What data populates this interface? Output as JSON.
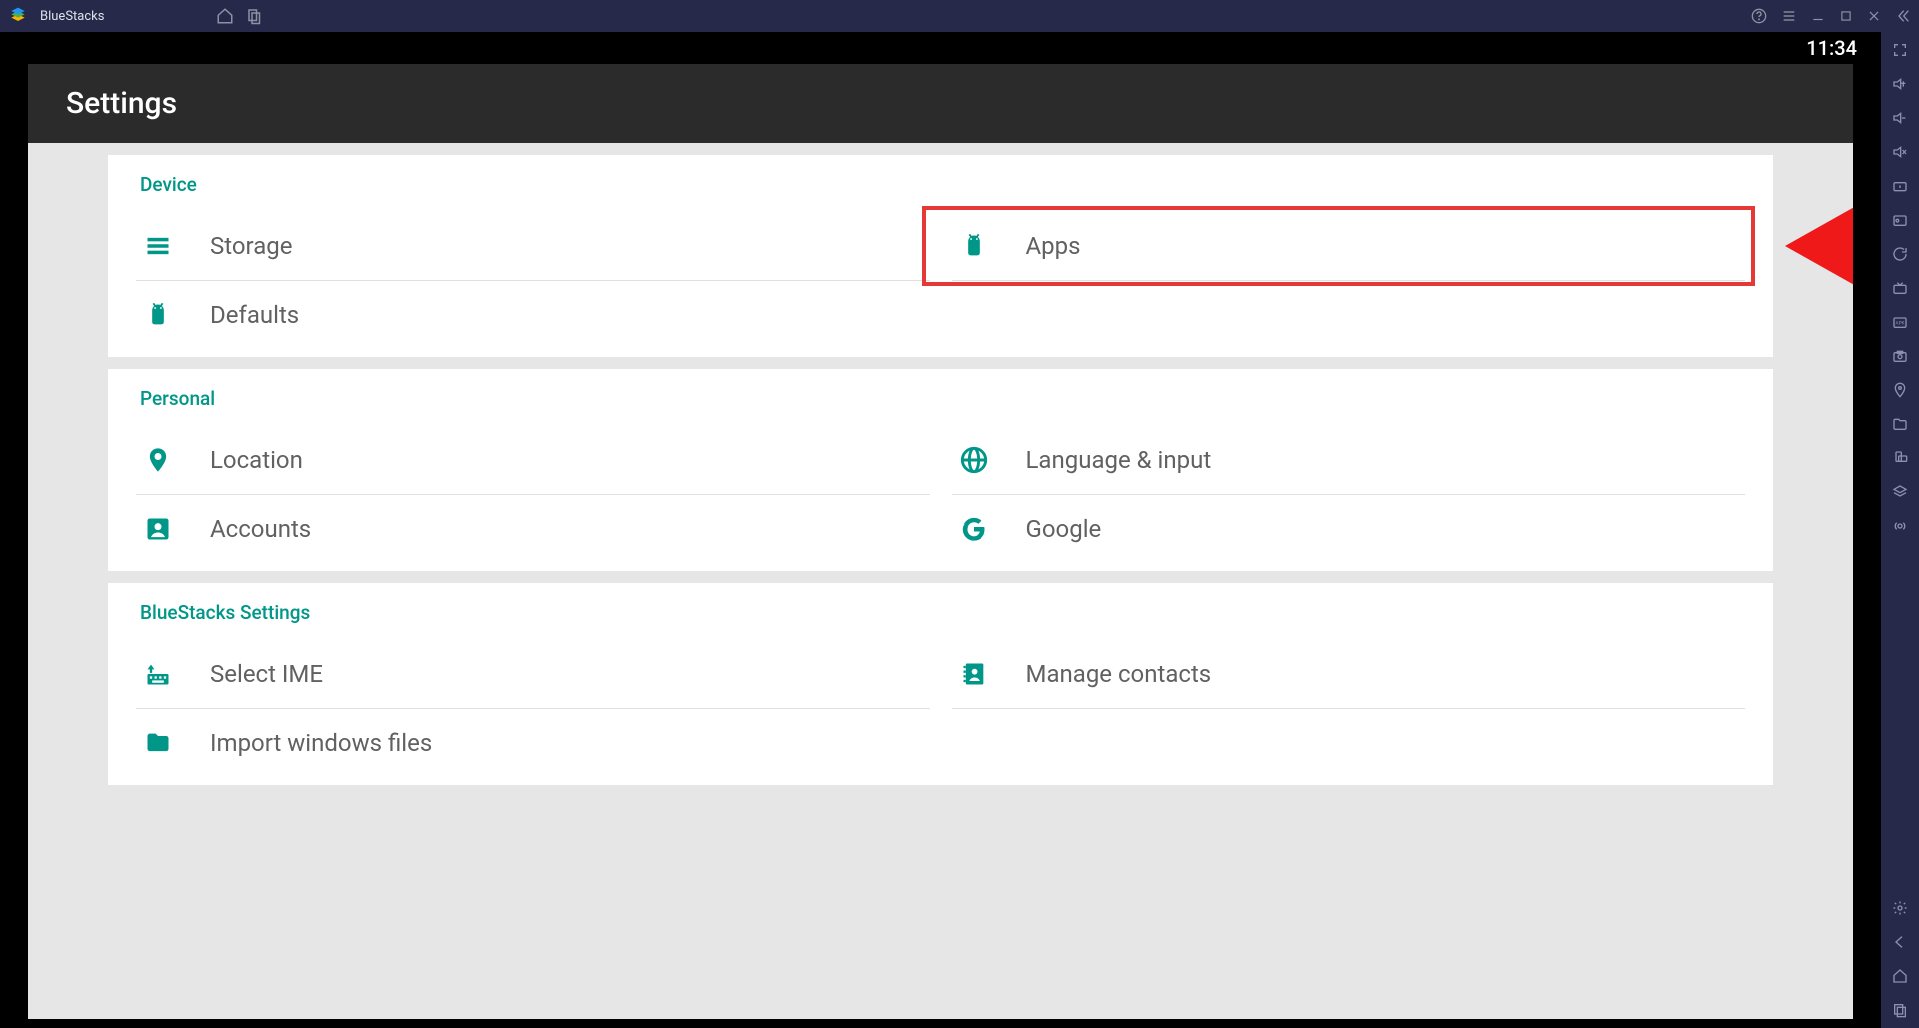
{
  "app_title": "BlueStacks",
  "status_time": "11:34",
  "page_title": "Settings",
  "sections": {
    "device": {
      "title": "Device",
      "storage": "Storage",
      "apps": "Apps",
      "defaults": "Defaults"
    },
    "personal": {
      "title": "Personal",
      "location": "Location",
      "language": "Language & input",
      "accounts": "Accounts",
      "google": "Google"
    },
    "bluestacks": {
      "title": "BlueStacks Settings",
      "select_ime": "Select IME",
      "manage_contacts": "Manage contacts",
      "import_files": "Import windows files"
    }
  }
}
